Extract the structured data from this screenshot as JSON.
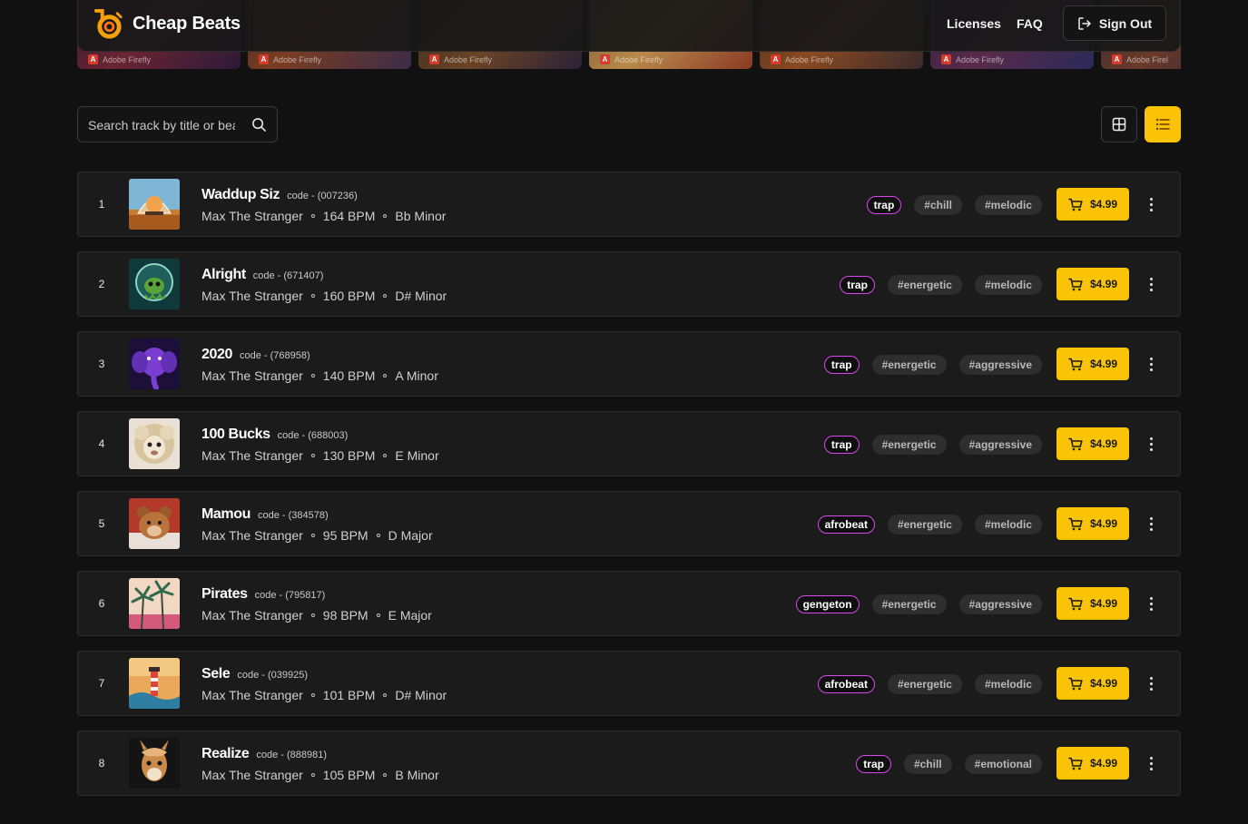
{
  "header": {
    "brand_name": "Cheap Beats",
    "nav": {
      "licenses": "Licenses",
      "faq": "FAQ"
    },
    "sign_out": "Sign Out",
    "banner_watermark": "Adobe Firefly",
    "banner_watermark_partial": "Adobe Firel"
  },
  "search": {
    "placeholder": "Search track by title or beat code"
  },
  "view": {
    "active": "list"
  },
  "colors": {
    "accent": "#fbc305",
    "genre_border": "#d946ef",
    "background": "#111111"
  },
  "tracks": [
    {
      "num": "1",
      "title": "Waddup Siz",
      "code": "code - (007236)",
      "artist": "Max The Stranger",
      "bpm": "164 BPM",
      "key": "Bb Minor",
      "genre": "trap",
      "tags": [
        "#chill",
        "#melodic"
      ],
      "price": "$4.99",
      "cover": "desert-aquarium"
    },
    {
      "num": "2",
      "title": "Alright",
      "code": "code - (671407)",
      "artist": "Max The Stranger",
      "bpm": "160 BPM",
      "key": "D# Minor",
      "genre": "trap",
      "tags": [
        "#energetic",
        "#melodic"
      ],
      "price": "$4.99",
      "cover": "alien-octopus"
    },
    {
      "num": "3",
      "title": "2020",
      "code": "code - (768958)",
      "artist": "Max The Stranger",
      "bpm": "140 BPM",
      "key": "A Minor",
      "genre": "trap",
      "tags": [
        "#energetic",
        "#aggressive"
      ],
      "price": "$4.99",
      "cover": "purple-elephant"
    },
    {
      "num": "4",
      "title": "100 Bucks",
      "code": "code - (688003)",
      "artist": "Max The Stranger",
      "bpm": "130 BPM",
      "key": "E Minor",
      "genre": "trap",
      "tags": [
        "#energetic",
        "#aggressive"
      ],
      "price": "$4.99",
      "cover": "fluffy-sheep"
    },
    {
      "num": "5",
      "title": "Mamou",
      "code": "code - (384578)",
      "artist": "Max The Stranger",
      "bpm": "95 BPM",
      "key": "D Major",
      "genre": "afrobeat",
      "tags": [
        "#energetic",
        "#melodic"
      ],
      "price": "$4.99",
      "cover": "bear-cub"
    },
    {
      "num": "6",
      "title": "Pirates",
      "code": "code - (795817)",
      "artist": "Max The Stranger",
      "bpm": "98 BPM",
      "key": "E Major",
      "genre": "gengeton",
      "tags": [
        "#energetic",
        "#aggressive"
      ],
      "price": "$4.99",
      "cover": "palm-trees"
    },
    {
      "num": "7",
      "title": "Sele",
      "code": "code - (039925)",
      "artist": "Max The Stranger",
      "bpm": "101 BPM",
      "key": "D# Minor",
      "genre": "afrobeat",
      "tags": [
        "#energetic",
        "#melodic"
      ],
      "price": "$4.99",
      "cover": "lighthouse"
    },
    {
      "num": "8",
      "title": "Realize",
      "code": "code - (888981)",
      "artist": "Max The Stranger",
      "bpm": "105 BPM",
      "key": "B Minor",
      "genre": "trap",
      "tags": [
        "#chill",
        "#emotional"
      ],
      "price": "$4.99",
      "cover": "llama"
    }
  ]
}
